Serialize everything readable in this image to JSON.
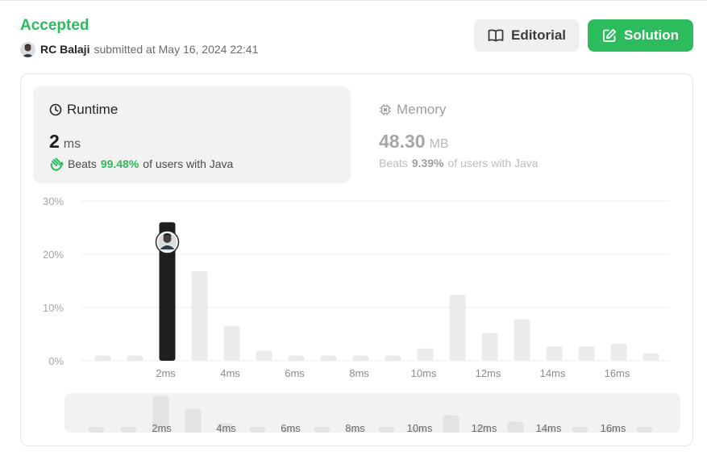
{
  "header": {
    "status": "Accepted",
    "submitter_name": "RC Balaji",
    "submitted_text": "submitted at May 16, 2024 22:41"
  },
  "buttons": {
    "editorial_label": "Editorial",
    "solution_label": "Solution"
  },
  "runtime": {
    "label": "Runtime",
    "value": "2",
    "unit": "ms",
    "beats_prefix": "Beats",
    "beats_pct": "99.48%",
    "beats_suffix": "of users with Java"
  },
  "memory": {
    "label": "Memory",
    "value": "48.30",
    "unit": "MB",
    "beats_prefix": "Beats",
    "beats_pct": "9.39%",
    "beats_suffix": "of users with Java"
  },
  "colors": {
    "accent_green": "#2cbb5d",
    "highlight_bar": "#1f1f1f",
    "bar": "#ebebeb"
  },
  "chart_data": {
    "type": "bar",
    "ylim": [
      0,
      30
    ],
    "y_ticks": [
      "0%",
      "10%",
      "20%",
      "30%"
    ],
    "y_tick_values": [
      0,
      10,
      20,
      30
    ],
    "x_tick_labels": [
      "2ms",
      "4ms",
      "6ms",
      "8ms",
      "10ms",
      "12ms",
      "14ms",
      "16ms"
    ],
    "x_tick_positions": [
      2,
      4,
      6,
      8,
      10,
      12,
      14,
      16
    ],
    "x": [
      0,
      1,
      2,
      3,
      4,
      5,
      6,
      7,
      8,
      9,
      10,
      11,
      12,
      13,
      14,
      15,
      16,
      17
    ],
    "values": [
      1.0,
      1.0,
      26.0,
      16.8,
      6.5,
      1.9,
      1.0,
      1.0,
      1.0,
      1.0,
      2.3,
      12.4,
      5.2,
      7.8,
      2.7,
      2.7,
      3.2,
      1.4
    ],
    "highlight_x": 2,
    "grid": true,
    "overview_tick_labels": [
      "2ms",
      "4ms",
      "6ms",
      "8ms",
      "10ms",
      "12ms",
      "14ms",
      "16ms"
    ]
  }
}
